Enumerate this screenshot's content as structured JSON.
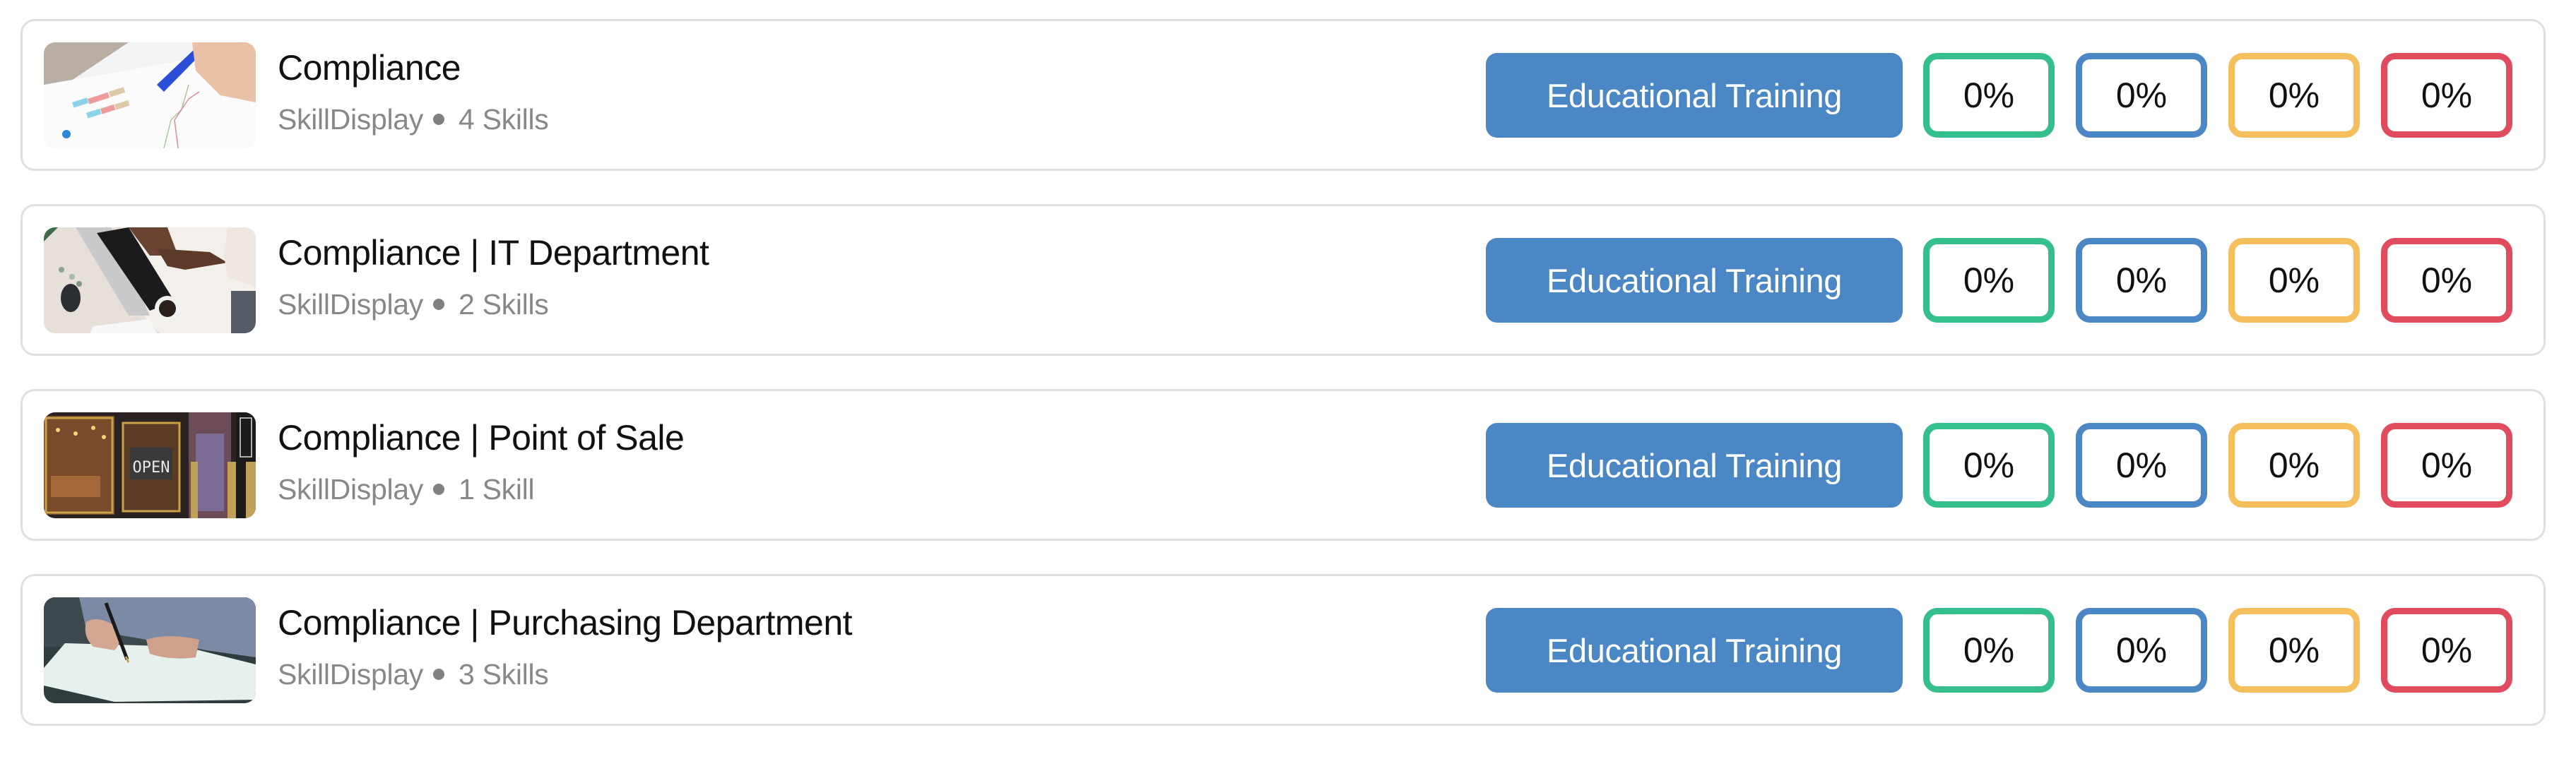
{
  "colors": {
    "button": "#4a87c4",
    "pct_borders": [
      "#35bf8d",
      "#4a87c4",
      "#f6bf5e",
      "#e04c5e"
    ]
  },
  "courses": [
    {
      "title": "Compliance",
      "provider": "SkillDisplay",
      "skills": "4 Skills",
      "thumbnail": "chart-analysis-photo",
      "button_label": "Educational Training",
      "percentages": [
        "0%",
        "0%",
        "0%",
        "0%"
      ]
    },
    {
      "title": "Compliance | IT Department",
      "provider": "SkillDisplay",
      "skills": "2 Skills",
      "thumbnail": "laptop-typing-photo",
      "button_label": "Educational Training",
      "percentages": [
        "0%",
        "0%",
        "0%",
        "0%"
      ]
    },
    {
      "title": "Compliance | Point of Sale",
      "provider": "SkillDisplay",
      "skills": "1 Skill",
      "thumbnail": "shop-open-sign-photo",
      "button_label": "Educational Training",
      "percentages": [
        "0%",
        "0%",
        "0%",
        "0%"
      ]
    },
    {
      "title": "Compliance | Purchasing Department",
      "provider": "SkillDisplay",
      "skills": "3 Skills",
      "thumbnail": "signing-document-photo",
      "button_label": "Educational Training",
      "percentages": [
        "0%",
        "0%",
        "0%",
        "0%"
      ]
    }
  ]
}
